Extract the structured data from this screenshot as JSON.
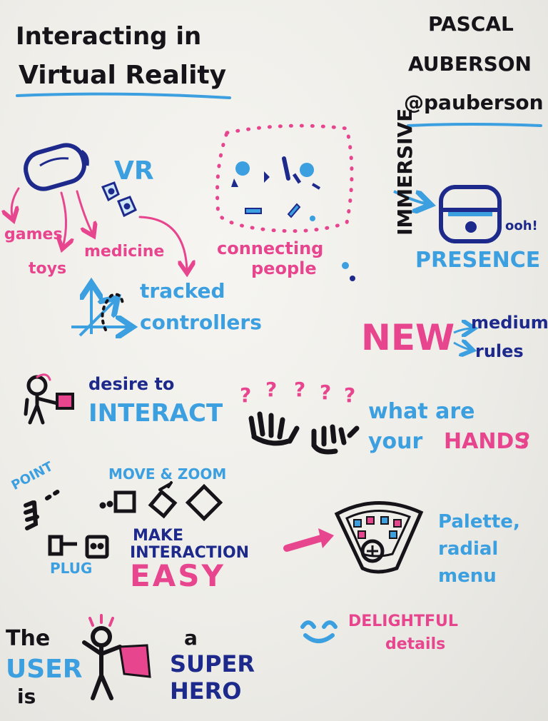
{
  "title": {
    "line1": "Interacting in",
    "line2": "Virtual Reality"
  },
  "speaker": {
    "first": "PASCAL",
    "last": "AUBERSON",
    "handle": "@pauberson"
  },
  "vr": {
    "label": "VR",
    "uses": {
      "games": "games",
      "toys": "toys",
      "medicine": "medicine"
    },
    "tracked": "tracked",
    "controllers": "controllers"
  },
  "connecting": {
    "line1": "connecting",
    "line2": "people"
  },
  "immersive": "IMMERSIVE",
  "presence": {
    "exclaim": "ooh!",
    "label": "PRESENCE"
  },
  "new_block": {
    "new": "NEW",
    "medium": "medium",
    "rules": "rules"
  },
  "interact": {
    "desire": "desire to",
    "interact": "INTERACT"
  },
  "hands": {
    "line1": "what are",
    "line2": "your",
    "hands": "HANDS",
    "q": "?"
  },
  "actions": {
    "point": "POINT",
    "move_zoom": "MOVE & ZOOM",
    "plug": "PLUG"
  },
  "make_easy": {
    "make": "MAKE",
    "interaction": "INTERACTION",
    "easy": "EASY"
  },
  "palette": {
    "line1": "Palette,",
    "line2": "radial",
    "line3": "menu"
  },
  "delightful": {
    "line1": "DELIGHTFUL",
    "line2": "details"
  },
  "user_hero": {
    "the": "The",
    "user": "USER",
    "is": "is",
    "a": "a",
    "super": "SUPER",
    "hero": "HERO"
  },
  "colors": {
    "ink_black": "#161319",
    "pink": "#e8458f",
    "blue": "#3b9fe0",
    "navy": "#1d2a8c",
    "paper": "#f2f1ec"
  }
}
